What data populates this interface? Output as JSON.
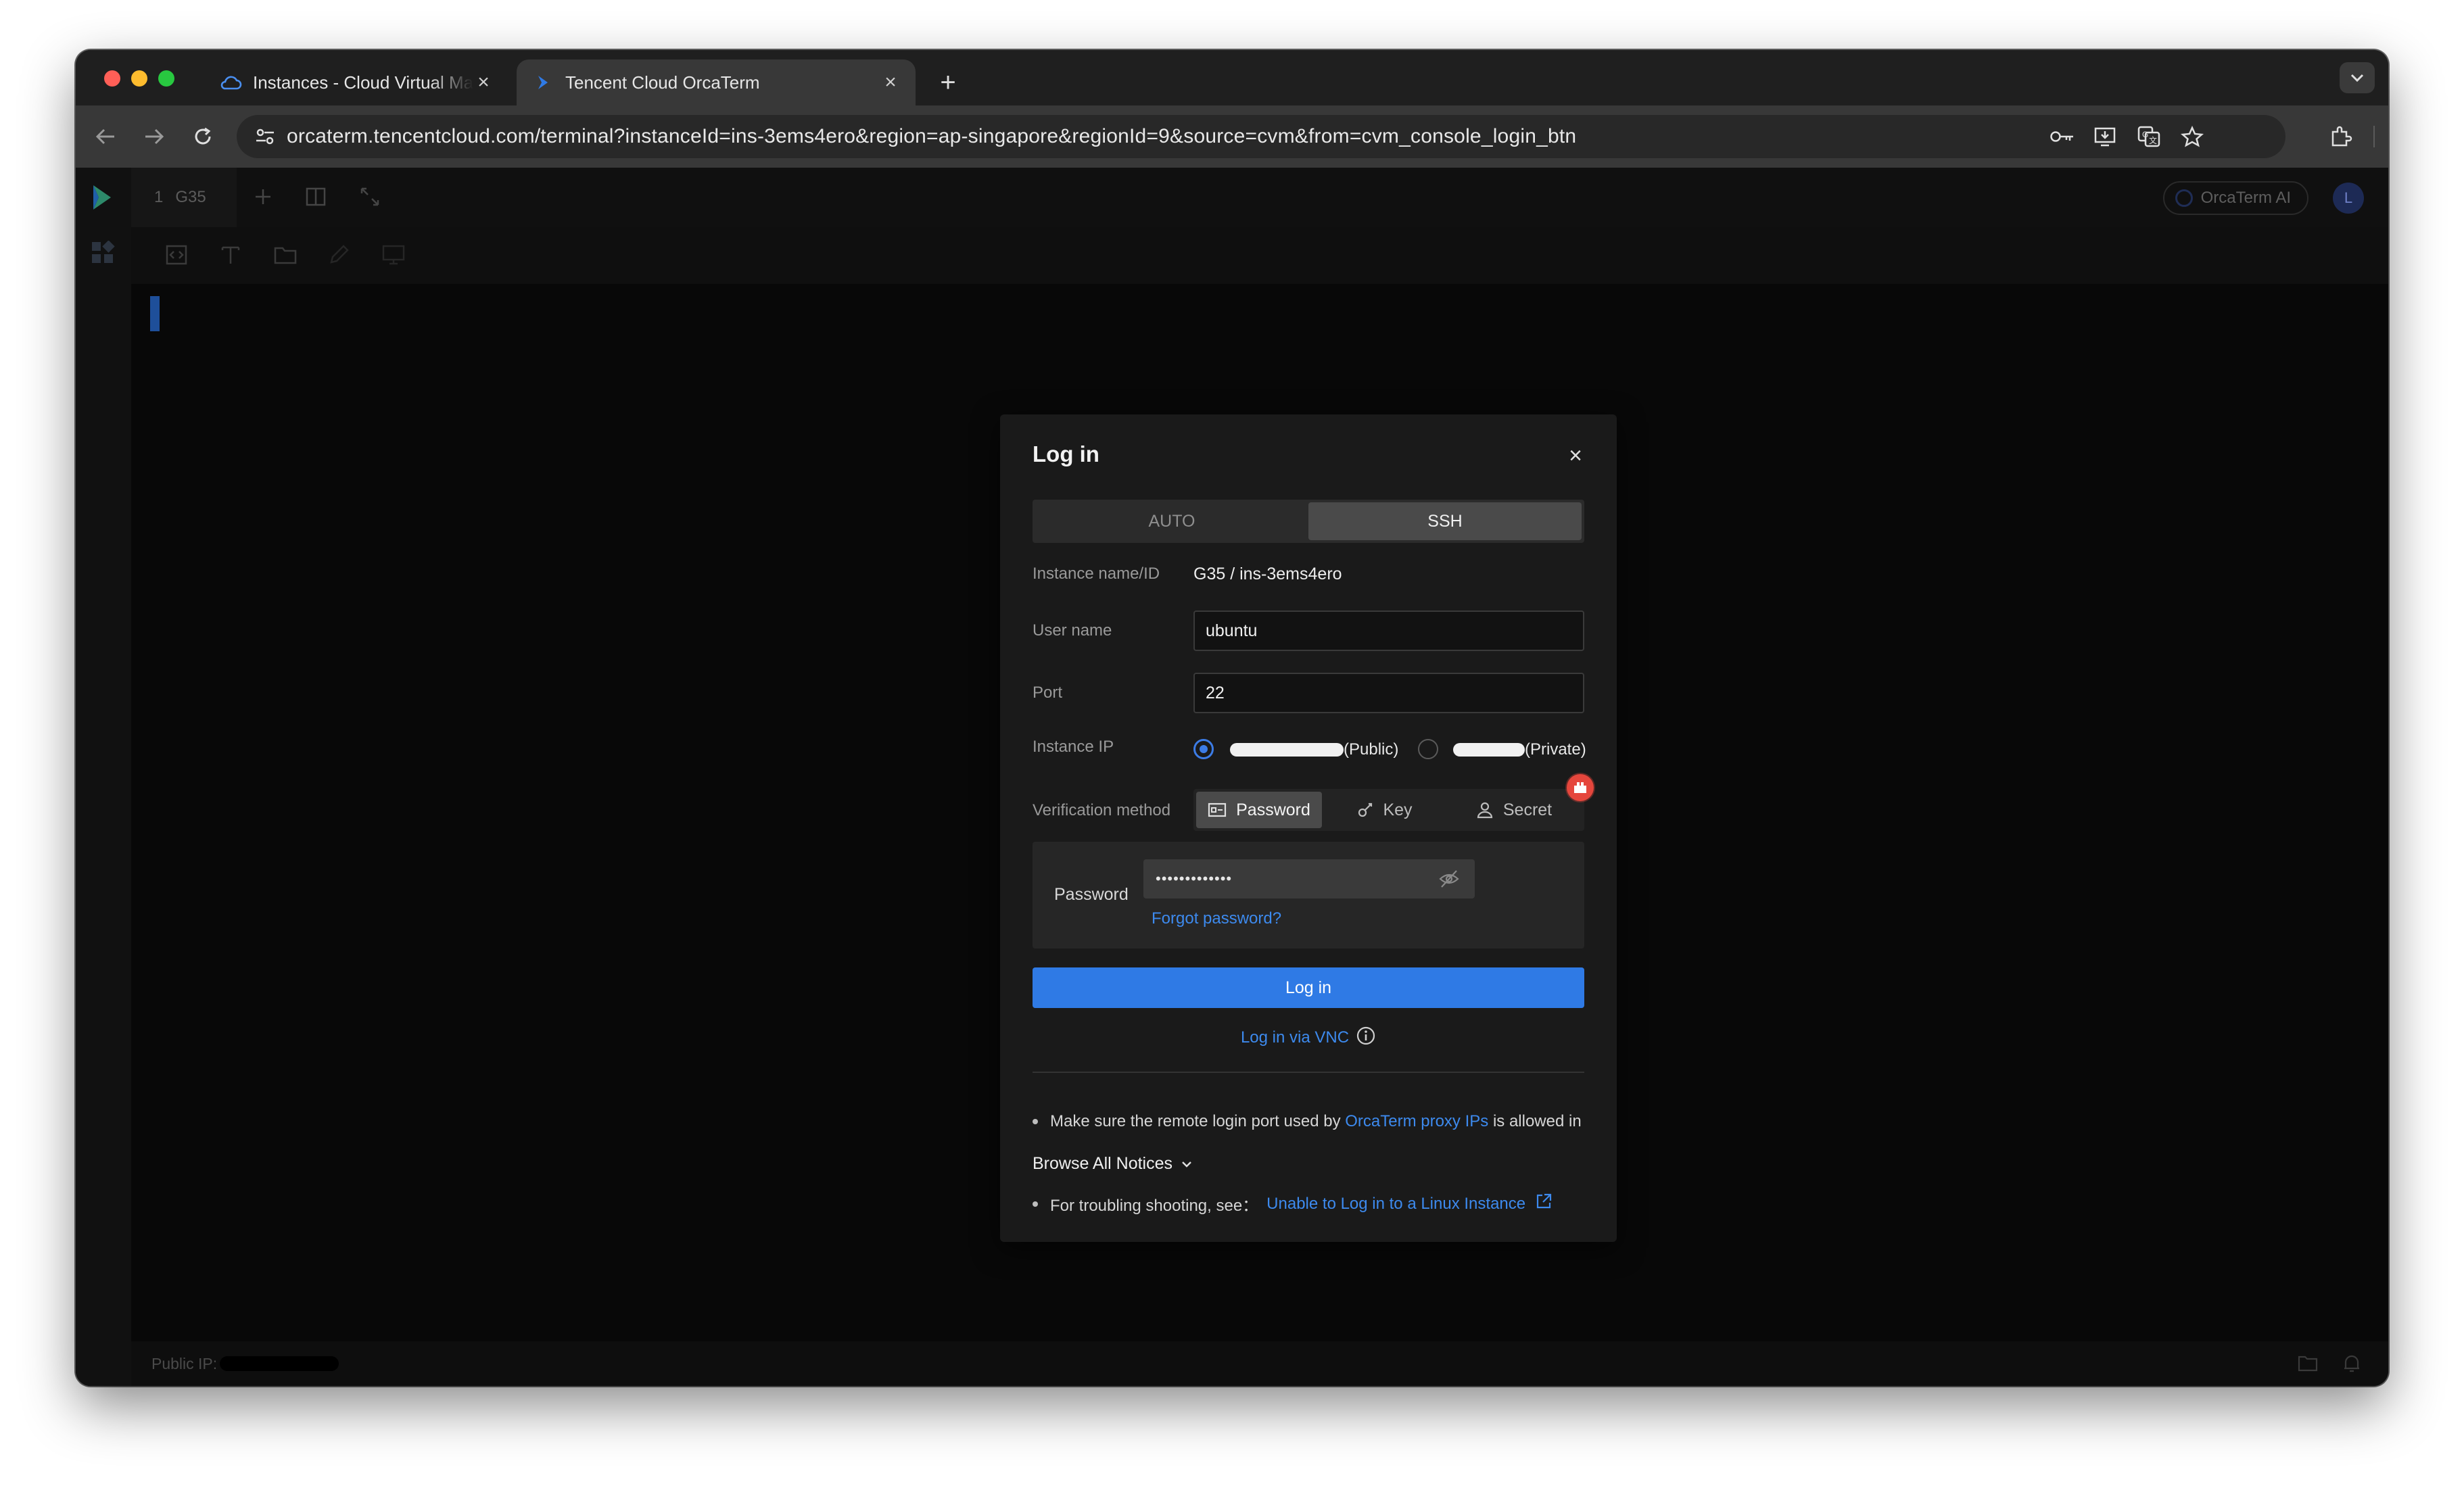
{
  "browser": {
    "tabs": [
      {
        "title": "Instances - Cloud Virtual Machine - Console",
        "active": false
      },
      {
        "title": "Tencent Cloud OrcaTerm",
        "active": true
      }
    ],
    "url": "orcaterm.tencentcloud.com/terminal?instanceId=ins-3ems4ero&region=ap-singapore&regionId=9&source=cvm&from=cvm_console_login_btn",
    "profile_initial": "·"
  },
  "app": {
    "session_tab": {
      "index": "1",
      "name": "G35"
    },
    "ai_button": "OrcaTerm AI",
    "user_initial": "L",
    "status": {
      "public_ip_label": "Public IP:"
    }
  },
  "dialog": {
    "title": "Log in",
    "modes": [
      {
        "label": "AUTO",
        "selected": false
      },
      {
        "label": "SSH",
        "selected": true
      }
    ],
    "instance": {
      "label": "Instance name/ID",
      "value": "G35 / ins-3ems4ero"
    },
    "username": {
      "label": "User name",
      "value": "ubuntu"
    },
    "port": {
      "label": "Port",
      "value": "22"
    },
    "instance_ip": {
      "label": "Instance IP",
      "public_suffix": "(Public)",
      "private_suffix": "(Private)",
      "selected": "public"
    },
    "verification": {
      "label": "Verification method",
      "options": [
        {
          "label": "Password",
          "selected": true
        },
        {
          "label": "Key",
          "selected": false
        },
        {
          "label": "Secret",
          "selected": false
        }
      ]
    },
    "password": {
      "label": "Password",
      "masked_value": "•••••••••••••",
      "forgot_link": "Forgot password?"
    },
    "login_button": "Log in",
    "vnc_link": "Log in via VNC",
    "notices": {
      "proxy_prefix": "Make sure the remote login port used by ",
      "proxy_link": "OrcaTerm proxy IPs",
      "proxy_suffix": " is allowed in",
      "browse_all": "Browse All Notices",
      "trouble_prefix": "For troubling shooting, see：",
      "trouble_link": "Unable to Log in to a Linux Instance"
    }
  },
  "colors": {
    "accent": "#2f7ae5",
    "link": "#3d8aee",
    "badge": "#e5463c"
  }
}
